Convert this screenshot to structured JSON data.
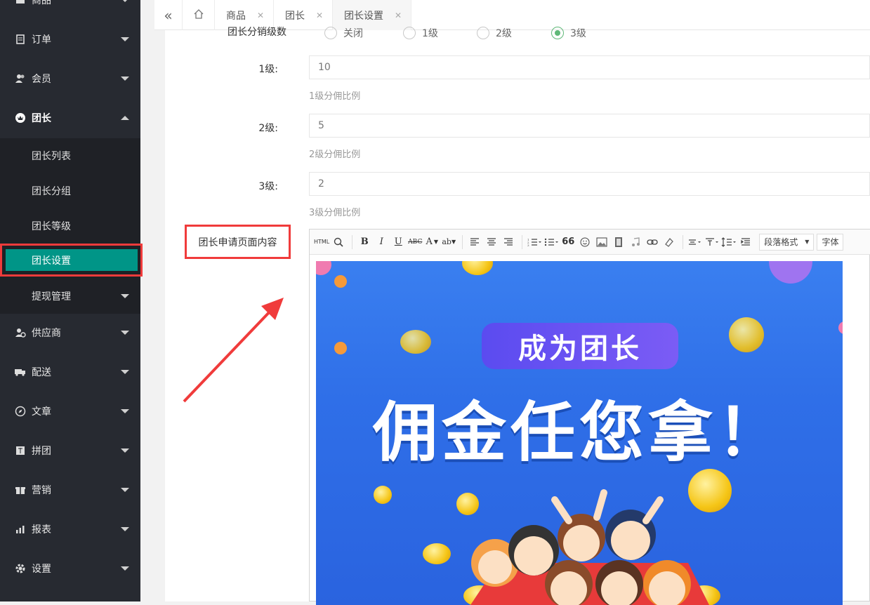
{
  "sidebar": {
    "items": [
      {
        "label": "商品",
        "icon": "goods-icon"
      },
      {
        "label": "订单",
        "icon": "order-icon"
      },
      {
        "label": "会员",
        "icon": "member-icon"
      },
      {
        "label": "团长",
        "icon": "crown-icon"
      },
      {
        "label": "供应商",
        "icon": "supplier-icon"
      },
      {
        "label": "配送",
        "icon": "truck-icon"
      },
      {
        "label": "文章",
        "icon": "compass-icon"
      },
      {
        "label": "拼团",
        "icon": "group-icon"
      },
      {
        "label": "营销",
        "icon": "gift-icon"
      },
      {
        "label": "报表",
        "icon": "chart-icon"
      },
      {
        "label": "设置",
        "icon": "gear-icon"
      }
    ],
    "sub_items": [
      "团长列表",
      "团长分组",
      "团长等级",
      "团长设置",
      "提现管理"
    ]
  },
  "tabs": [
    {
      "label": "商品"
    },
    {
      "label": "团长"
    },
    {
      "label": "团长设置"
    }
  ],
  "form": {
    "levels_label": "团长分销级数",
    "levels_options": [
      "关闭",
      "1级",
      "2级",
      "3级"
    ],
    "levels_selected": "3级",
    "level1_label": "1级:",
    "level1_value": "10",
    "level1_help": "1级分佣比例",
    "level2_label": "2级:",
    "level2_value": "5",
    "level2_help": "2级分佣比例",
    "level3_label": "3级:",
    "level3_value": "2",
    "level3_help": "3级分佣比例",
    "content_label": "团长申请页面内容"
  },
  "editor": {
    "toolbar": [
      "HTML",
      "B",
      "I",
      "U",
      "ABC",
      "A",
      "ab",
      "66"
    ],
    "paragraph_format": "段落格式",
    "font": "字体"
  },
  "banner": {
    "pill_text": "成为团长",
    "headline": "佣金任您拿！"
  },
  "colors": {
    "sidebar_bg": "#272a31",
    "active_green": "#009587",
    "highlight_red": "#f03b3b",
    "radio_green": "#5fb878"
  }
}
